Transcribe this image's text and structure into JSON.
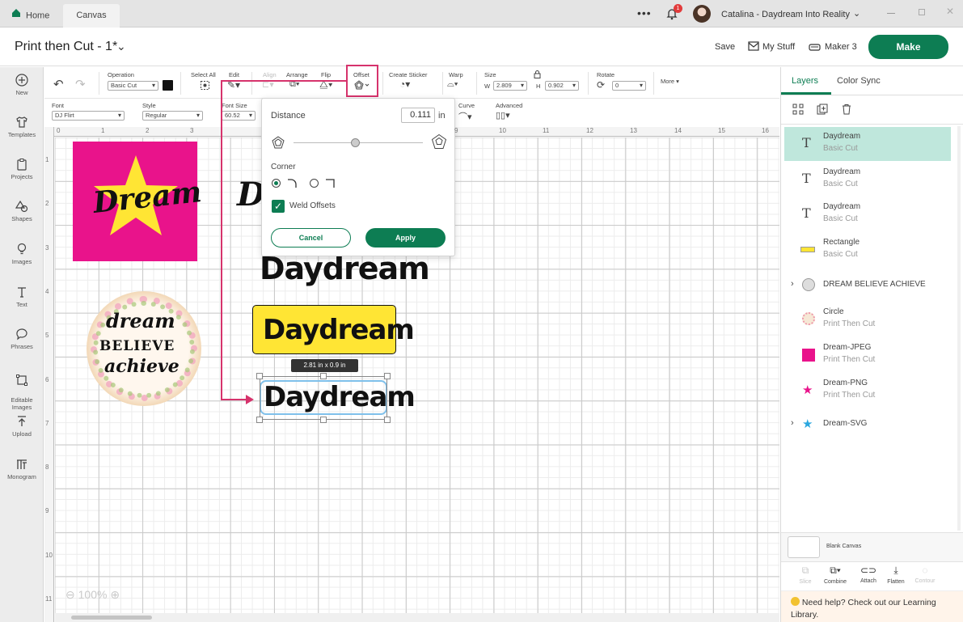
{
  "tabs": {
    "home": "Home",
    "canvas": "Canvas"
  },
  "window": {
    "notification_count": "1",
    "user_name": "Catalina - Daydream Into Reality"
  },
  "header": {
    "project_title": "Print then Cut - 1*",
    "save": "Save",
    "my_stuff": "My Stuff",
    "machine": "Maker 3",
    "make": "Make"
  },
  "left_rail": [
    {
      "label": "New",
      "icon": "plus-circle-icon"
    },
    {
      "label": "Templates",
      "icon": "shirt-icon"
    },
    {
      "label": "Projects",
      "icon": "clipboard-icon"
    },
    {
      "label": "Shapes",
      "icon": "shapes-icon"
    },
    {
      "label": "Images",
      "icon": "lightbulb-icon"
    },
    {
      "label": "Text",
      "icon": "text-icon"
    },
    {
      "label": "Phrases",
      "icon": "speech-icon"
    },
    {
      "label": "Editable\nImages",
      "icon": "editable-image-icon"
    },
    {
      "label": "Upload",
      "icon": "upload-icon"
    },
    {
      "label": "Monogram",
      "icon": "monogram-icon"
    }
  ],
  "toolbar": {
    "operation_label": "Operation",
    "operation_value": "Basic Cut",
    "select_all": "Select All",
    "edit": "Edit",
    "align": "Align",
    "arrange": "Arrange",
    "flip": "Flip",
    "offset": "Offset",
    "create_sticker": "Create Sticker",
    "warp": "Warp",
    "size": "Size",
    "w_label": "W",
    "w_value": "2.809",
    "h_label": "H",
    "h_value": "0.902",
    "rotate": "Rotate",
    "rotate_value": "0",
    "more": "More"
  },
  "toolbar2": {
    "font_label": "Font",
    "font_value": "DJ Flirt",
    "style_label": "Style",
    "style_value": "Regular",
    "font_size_label": "Font Size",
    "font_size_value": "60.52",
    "curve_label": "Curve",
    "advanced_label": "Advanced"
  },
  "ruler": {
    "top": [
      "0",
      "1",
      "2",
      "3",
      "9",
      "10",
      "11",
      "12",
      "13",
      "14",
      "15",
      "16"
    ],
    "left": [
      "1",
      "2",
      "3",
      "4",
      "5",
      "6",
      "7",
      "8",
      "9",
      "10",
      "11"
    ]
  },
  "offset_popup": {
    "distance_label": "Distance",
    "distance_value": "0.111",
    "unit": "in",
    "slider_value": 0.4,
    "corner_label": "Corner",
    "weld_label": "Weld Offsets",
    "cancel": "Cancel",
    "apply": "Apply"
  },
  "canvas": {
    "dream_jpeg_text": "Dream",
    "daydream_plain": "Daydream",
    "daydream_yellow": "Daydream",
    "daydream_selected": "Daydream",
    "dim_badge": "2.81  in x 0.9  in",
    "circle_text": [
      "dream",
      "BELIEVE",
      "achieve"
    ],
    "svg_partial": "Dr",
    "zoom": "100%",
    "colors": {
      "pink": "#e9138b",
      "yellow": "#ffe534",
      "blue": "#2aa7df",
      "arrow": "#d6336c"
    }
  },
  "right_panel": {
    "tab_layers": "Layers",
    "tab_color_sync": "Color Sync",
    "layers": [
      {
        "name": "Daydream",
        "sub": "Basic Cut",
        "icon": "T"
      },
      {
        "name": "Daydream",
        "sub": "Basic Cut",
        "icon": "T"
      },
      {
        "name": "Daydream",
        "sub": "Basic Cut",
        "icon": "T"
      },
      {
        "name": "Rectangle",
        "sub": "Basic Cut",
        "icon": "rect"
      },
      {
        "name": "DREAM BELIEVE ACHIEVE",
        "sub": "",
        "icon": "group"
      },
      {
        "name": "Circle",
        "sub": "Print Then Cut",
        "icon": "circle"
      },
      {
        "name": "Dream-JPEG",
        "sub": "Print Then Cut",
        "icon": "jpeg"
      },
      {
        "name": "Dream-PNG",
        "sub": "Print Then Cut",
        "icon": "png"
      },
      {
        "name": "Dream-SVG",
        "sub": "",
        "icon": "svg"
      }
    ],
    "blank_canvas": "Blank Canvas",
    "bottom_actions": [
      "Slice",
      "Combine",
      "Attach",
      "Flatten",
      "Contour"
    ],
    "help_text": "Need help? Check out our Learning Library."
  }
}
